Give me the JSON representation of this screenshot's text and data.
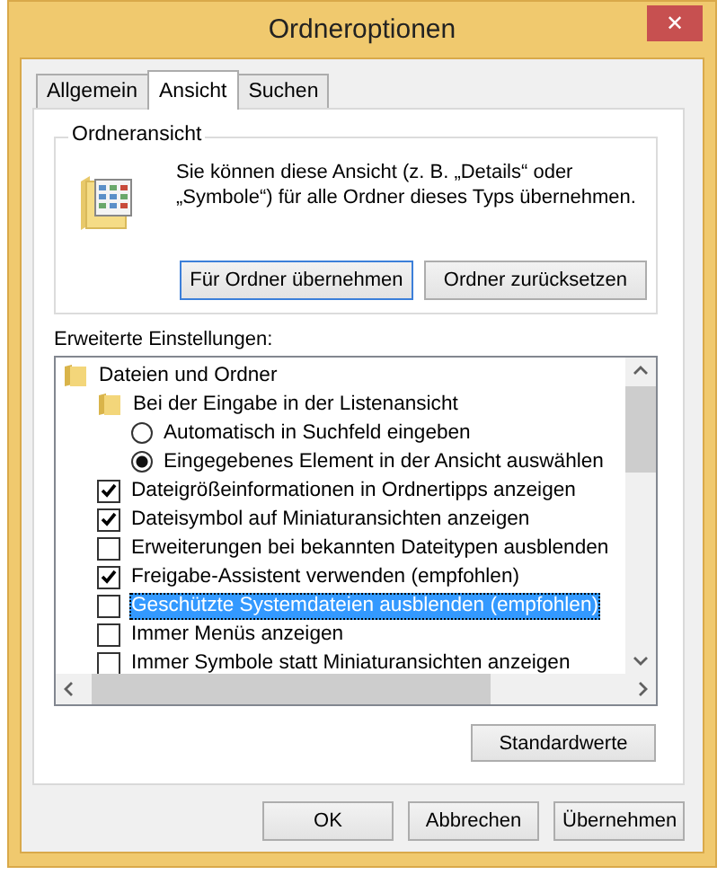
{
  "window": {
    "title": "Ordneroptionen",
    "close": "✕"
  },
  "tabs": [
    {
      "label": "Allgemein",
      "selected": false
    },
    {
      "label": "Ansicht",
      "selected": true
    },
    {
      "label": "Suchen",
      "selected": false
    }
  ],
  "folder_view": {
    "title": "Ordneransicht",
    "description": "Sie können diese Ansicht (z. B. „Details“ oder „Symbole“) für alle Ordner dieses Typs übernehmen.",
    "buttons": [
      {
        "label": "Für Ordner übernehmen",
        "focused": true
      },
      {
        "label": "Ordner zurücksetzen",
        "focused": false
      }
    ]
  },
  "advanced": {
    "title": "Erweiterte Einstellungen:",
    "items": [
      {
        "kind": "folder",
        "label": "Dateien und Ordner",
        "selected": false,
        "children": [
          {
            "kind": "folder",
            "label": "Bei der Eingabe in der Listenansicht",
            "selected": false,
            "children": [
              {
                "kind": "radio",
                "label": "Automatisch in Suchfeld eingeben",
                "checked": false,
                "selected": false
              },
              {
                "kind": "radio",
                "label": "Eingegebenes Element in der Ansicht auswählen",
                "checked": true,
                "selected": false
              }
            ]
          },
          {
            "kind": "checkbox",
            "label": "Dateigrößeinformationen in Ordnertipps anzeigen",
            "checked": true,
            "selected": false
          },
          {
            "kind": "checkbox",
            "label": "Dateisymbol auf Miniaturansichten anzeigen",
            "checked": true,
            "selected": false
          },
          {
            "kind": "checkbox",
            "label": "Erweiterungen bei bekannten Dateitypen ausblenden",
            "checked": false,
            "selected": false
          },
          {
            "kind": "checkbox",
            "label": "Freigabe-Assistent verwenden (empfohlen)",
            "checked": true,
            "selected": false
          },
          {
            "kind": "checkbox",
            "label": "Geschützte Systemdateien ausblenden (empfohlen)",
            "checked": false,
            "selected": true
          },
          {
            "kind": "checkbox",
            "label": "Immer Menüs anzeigen",
            "checked": false,
            "selected": false
          },
          {
            "kind": "checkbox",
            "label": "Immer Symbole statt Miniaturansichten anzeigen",
            "checked": false,
            "selected": false
          }
        ]
      }
    ],
    "restore_button": "Standardwerte"
  },
  "buttons": [
    "OK",
    "Abbrechen",
    "Übernehmen"
  ]
}
